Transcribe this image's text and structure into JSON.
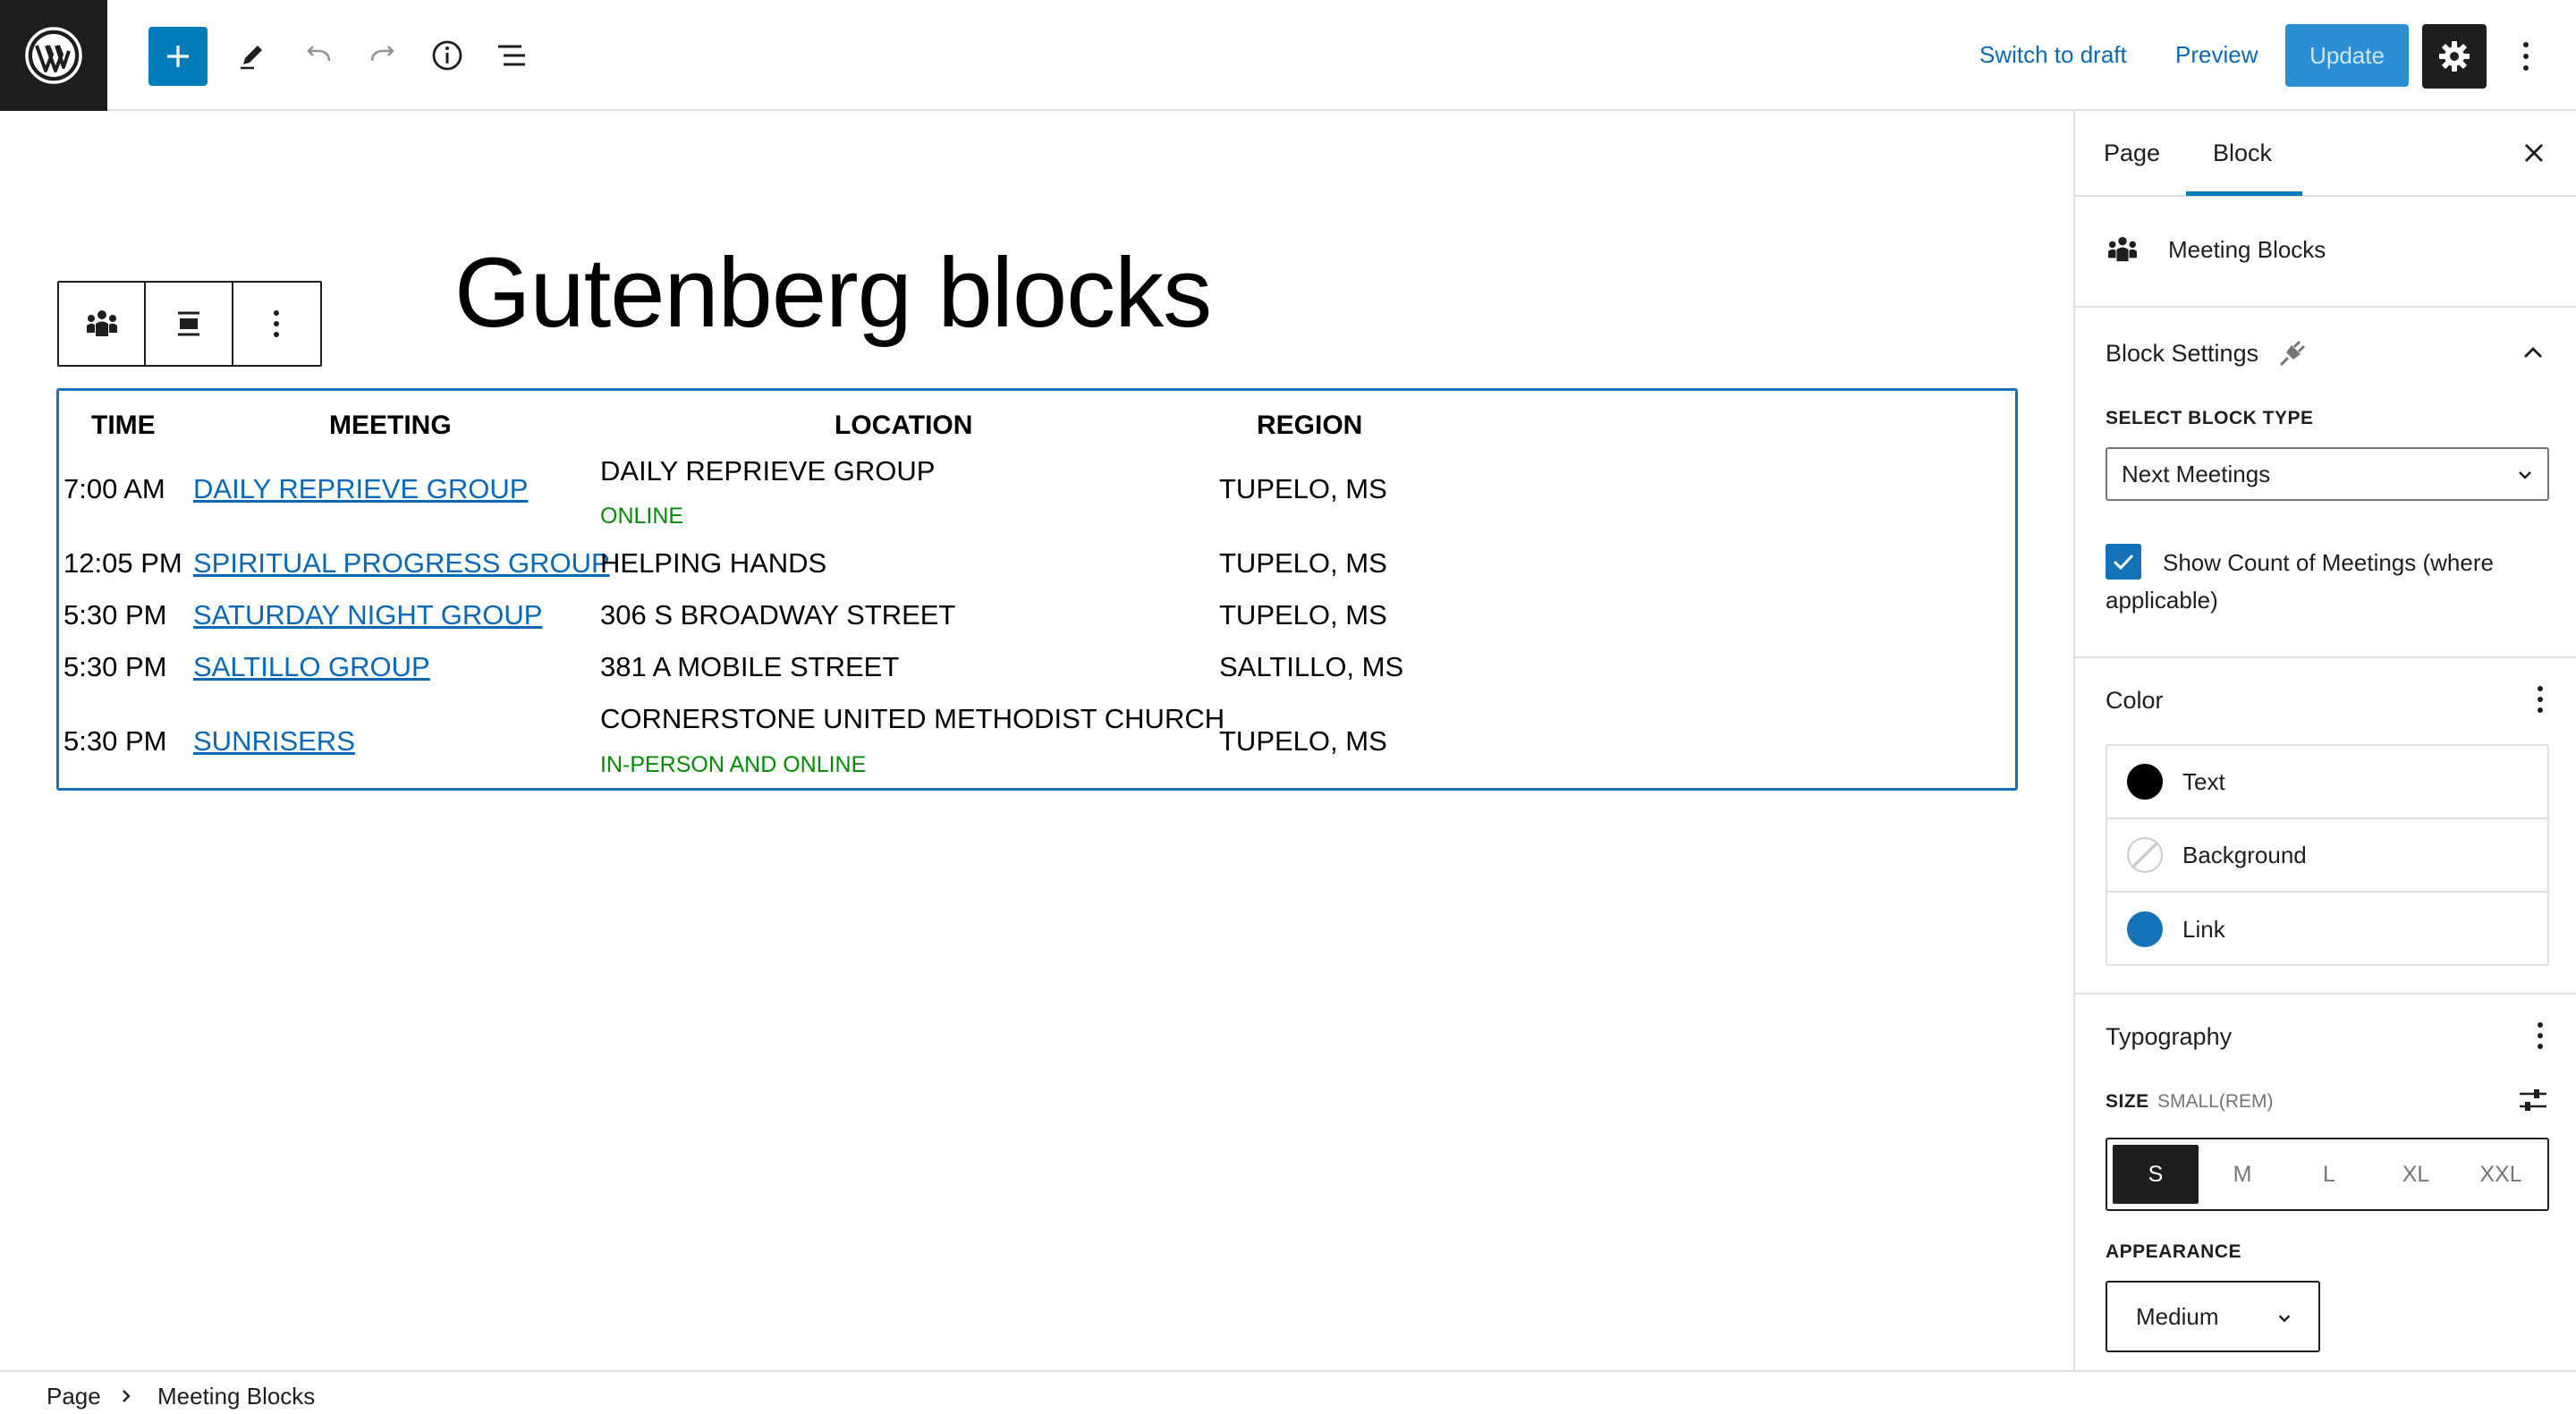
{
  "topbar": {
    "switch_to_draft": "Switch to draft",
    "preview": "Preview",
    "update": "Update"
  },
  "editor": {
    "title": "Gutenberg blocks",
    "table": {
      "headers": {
        "time": "TIME",
        "meeting": "MEETING",
        "location": "LOCATION",
        "region": "REGION"
      },
      "rows": [
        {
          "time": "7:00 AM",
          "meeting": "DAILY REPRIEVE GROUP",
          "location": "DAILY REPRIEVE GROUP",
          "location_sub": "ONLINE",
          "region": "TUPELO, MS"
        },
        {
          "time": "12:05 PM",
          "meeting": "SPIRITUAL PROGRESS GROUP",
          "location": "HELPING HANDS",
          "location_sub": "",
          "region": "TUPELO, MS"
        },
        {
          "time": "5:30 PM",
          "meeting": "SATURDAY NIGHT GROUP",
          "location": "306 S BROADWAY STREET",
          "location_sub": "",
          "region": "TUPELO, MS"
        },
        {
          "time": "5:30 PM",
          "meeting": "SALTILLO GROUP",
          "location": "381 A MOBILE STREET",
          "location_sub": "",
          "region": "SALTILLO, MS"
        },
        {
          "time": "5:30 PM",
          "meeting": "SUNRISERS",
          "location": "CORNERSTONE UNITED METHODIST CHURCH",
          "location_sub": "IN-PERSON AND ONLINE",
          "region": "TUPELO, MS"
        }
      ]
    }
  },
  "sidebar": {
    "tabs": {
      "page": "Page",
      "block": "Block"
    },
    "block_name": "Meeting Blocks",
    "block_settings": {
      "title": "Block Settings",
      "select_block_type_label": "SELECT BLOCK TYPE",
      "select_block_type_value": "Next Meetings",
      "show_count_label": "Show Count of Meetings (where applicable)",
      "show_count_checked": true
    },
    "color": {
      "title": "Color",
      "items": [
        {
          "label": "Text",
          "swatch": "#000000"
        },
        {
          "label": "Background",
          "swatch": "transparent"
        },
        {
          "label": "Link",
          "swatch": "#1473b8"
        }
      ]
    },
    "typography": {
      "title": "Typography",
      "size_label": "SIZE",
      "size_hint": "SMALL(REM)",
      "sizes": [
        "S",
        "M",
        "L",
        "XL",
        "XXL"
      ],
      "selected_size": "S",
      "appearance_label": "APPEARANCE",
      "appearance_value": "Medium"
    }
  },
  "breadcrumb": {
    "items": [
      "Page",
      "Meeting Blocks"
    ]
  },
  "colors": {
    "accent": "#007cba",
    "link": "#0b68b5",
    "success": "#008a00",
    "dark": "#1e1e1e"
  }
}
